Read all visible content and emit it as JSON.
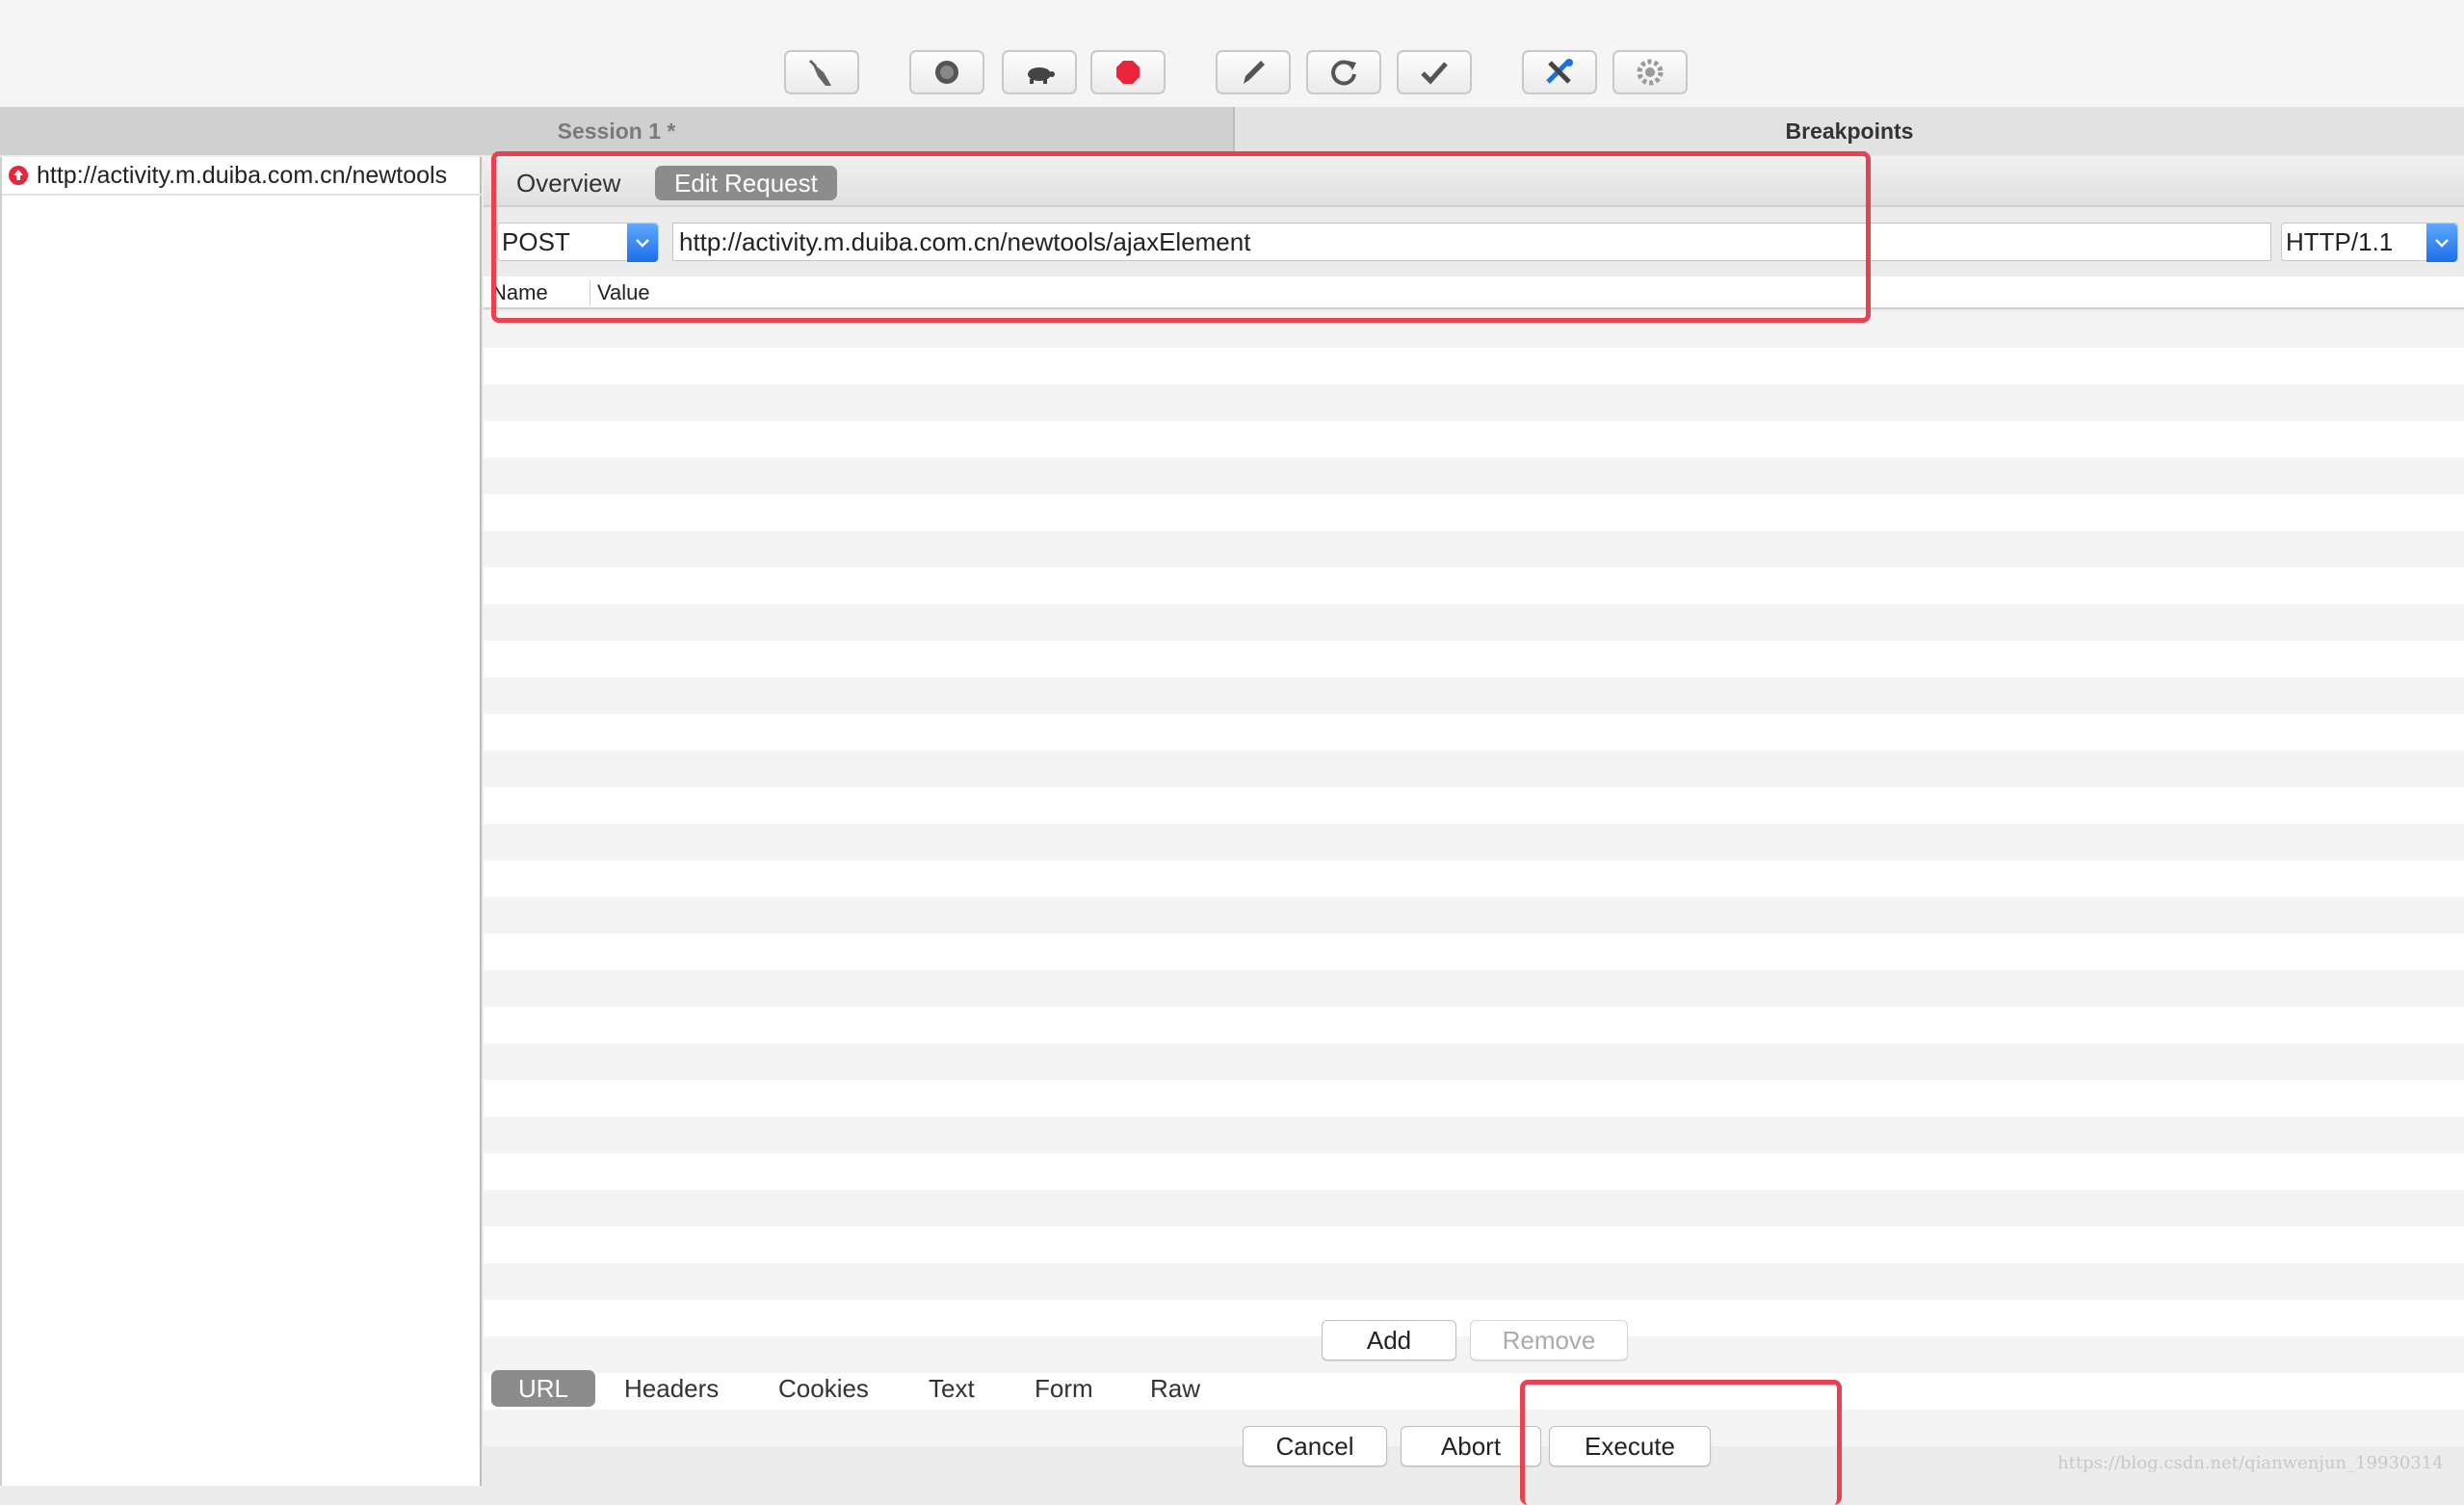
{
  "toolbar": {
    "buttons": [
      {
        "name": "clear-broom-icon"
      },
      {
        "name": "record-icon"
      },
      {
        "name": "throttle-turtle-icon"
      },
      {
        "name": "breakpoint-stop-icon",
        "color": "#e8253a"
      },
      {
        "name": "compose-pen-icon"
      },
      {
        "name": "repeat-icon"
      },
      {
        "name": "validate-check-icon"
      },
      {
        "name": "tools-icon"
      },
      {
        "name": "settings-gear-icon"
      }
    ]
  },
  "tabs": {
    "session": "Session 1 *",
    "breakpoints": "Breakpoints"
  },
  "left": {
    "entry_url": "http://activity.m.duiba.com.cn/newtools"
  },
  "subtabs": {
    "overview": "Overview",
    "edit_request": "Edit Request"
  },
  "request": {
    "method": "POST",
    "url": "http://activity.m.duiba.com.cn/newtools/ajaxElement",
    "protocol": "HTTP/1.1"
  },
  "table": {
    "name_header": "Name",
    "value_header": "Value"
  },
  "actions": {
    "add": "Add",
    "remove": "Remove"
  },
  "bottom_tabs": {
    "url": "URL",
    "headers": "Headers",
    "cookies": "Cookies",
    "text": "Text",
    "form": "Form",
    "raw": "Raw"
  },
  "buttons": {
    "cancel": "Cancel",
    "abort": "Abort",
    "execute": "Execute"
  },
  "watermark": "https://blog.csdn.net/qianwenjun_19930314",
  "colors": {
    "highlight": "#e8414f",
    "accent_blue": "#1c6fe8",
    "selected_tab": "#8c8c8c"
  }
}
